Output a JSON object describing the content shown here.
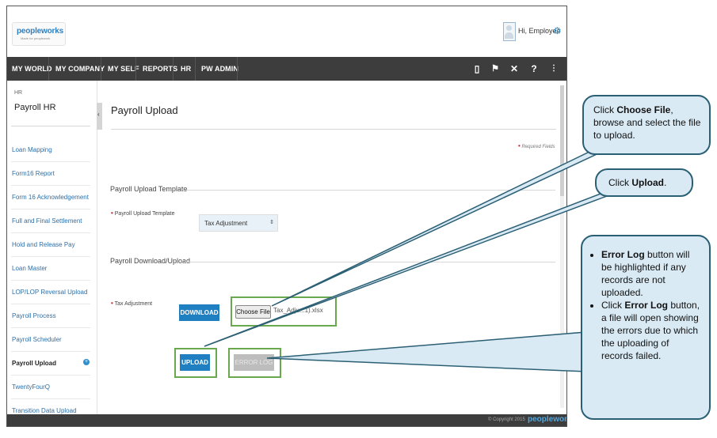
{
  "header": {
    "logo_text": "peopleworks",
    "logo_sub": "Made for peoplework",
    "greeting": "Hi, Employee"
  },
  "nav": {
    "items": [
      "MY WORLD",
      "MY COMPANY",
      "MY SELF",
      "REPORTS",
      "HR",
      "PW ADMIN"
    ],
    "icons": [
      "book-icon",
      "flag-icon",
      "tools-icon",
      "help-icon",
      "sitemap-icon"
    ]
  },
  "sidebar": {
    "category": "HR",
    "title": "Payroll HR",
    "items": [
      "Loan Mapping",
      "Form16 Report",
      "Form 16 Acknowledgement",
      "Full and Final Settlement",
      "Hold and Release Pay",
      "Loan Master",
      "LOP/LOP Reversal Upload",
      "Payroll Process",
      "Payroll Scheduler",
      "Payroll Upload",
      "TwentyFourQ",
      "Transition Data Upload"
    ],
    "active_index": 9
  },
  "main": {
    "page_title": "Payroll Upload",
    "required_note": "Required Fields",
    "section_template": "Payroll Upload Template",
    "template_label": "Payroll Upload Template",
    "template_value": "Tax Adjustment",
    "section_download": "Payroll Download/Upload",
    "tax_label": "Tax Adjustment",
    "download_label": "DOWNLOAD",
    "choose_file_label": "Choose File",
    "file_name": "Tax_Adju...1).xlsx",
    "upload_label": "UPLOAD",
    "error_log_label": "ERROR LOG"
  },
  "footer": {
    "copyright": "© Copyright 2015",
    "logo_text": "peopleworks"
  },
  "callouts": {
    "choose_file": {
      "pre": "Click ",
      "bold": "Choose File",
      "post": ", browse and select the file to upload."
    },
    "upload": {
      "pre": "Click ",
      "bold": "Upload",
      "post": "."
    },
    "error_log": [
      {
        "bold": "Error Log",
        "post": " button will be highlighted if any records are not uploaded."
      },
      {
        "pre": "Click ",
        "bold": "Error Log",
        "post": " button, a file will open showing the errors due to which the uploading of records failed."
      }
    ]
  },
  "colors": {
    "nav_bg": "#3d3d3d",
    "primary_button": "#1f7fc0",
    "highlight_box": "#6aa84f",
    "callout_bg": "#d9eaf4",
    "callout_border": "#2b5f74",
    "required": "#d9202c"
  }
}
